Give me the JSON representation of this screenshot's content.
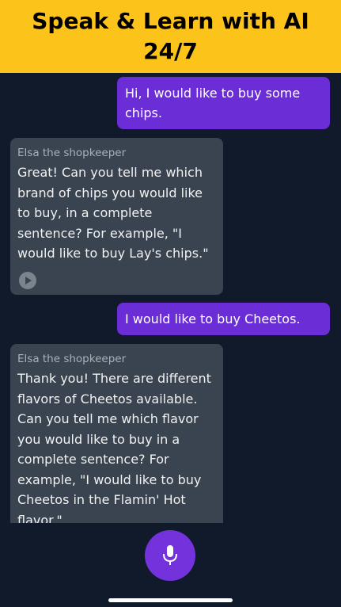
{
  "header": {
    "title": "Speak & Learn with AI 24/7"
  },
  "messages": [
    {
      "role": "user",
      "text": "Hi, I would like to buy some chips."
    },
    {
      "role": "assistant",
      "sender": "Elsa the shopkeeper",
      "text": "Great! Can you tell me which brand of chips you would like to buy, in a complete sentence? For example, \"I would like to buy Lay's chips.\""
    },
    {
      "role": "user",
      "text": "I would like to buy Cheetos."
    },
    {
      "role": "assistant",
      "sender": "Elsa the shopkeeper",
      "text": "Thank you! There are different flavors of Cheetos available. Can you tell me which flavor you would like to buy in a complete sentence? For example, \"I would like to buy Cheetos in the Flamin' Hot flavor.\""
    }
  ],
  "icons": {
    "play": "play-icon",
    "mic": "microphone-icon"
  },
  "colors": {
    "header_bg": "#fcc31a",
    "user_bubble": "#6b2ed6",
    "assistant_bubble": "#3a4350",
    "background": "#111a2b",
    "mic_button": "#7432dc"
  }
}
